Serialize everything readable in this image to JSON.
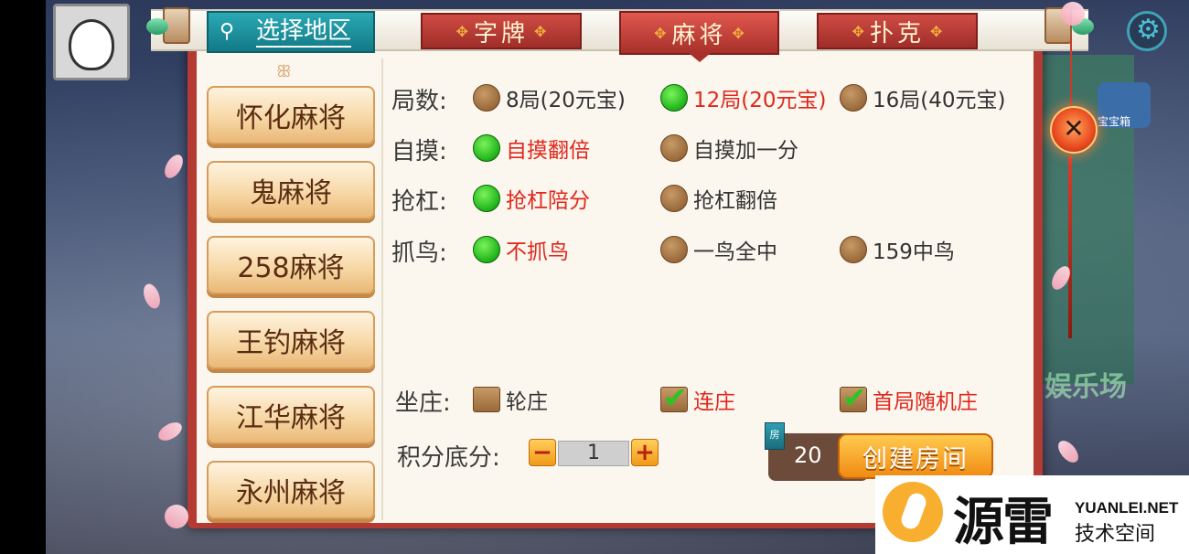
{
  "tabs": {
    "region": "选择地区",
    "zipai": "字牌",
    "majiang": "麻将",
    "puke": "扑克",
    "active": "麻将"
  },
  "game_list": [
    "怀化麻将",
    "鬼麻将",
    "258麻将",
    "王钓麻将",
    "江华麻将",
    "永州麻将"
  ],
  "options": {
    "rounds": {
      "label": "局数:",
      "choices": [
        {
          "text": "8局(20元宝)",
          "selected": false
        },
        {
          "text": "12局(20元宝)",
          "selected": true
        },
        {
          "text": "16局(40元宝)",
          "selected": false
        }
      ]
    },
    "self_draw": {
      "label": "自摸:",
      "choices": [
        {
          "text": "自摸翻倍",
          "selected": true
        },
        {
          "text": "自摸加一分",
          "selected": false
        }
      ]
    },
    "rob_kong": {
      "label": "抢杠:",
      "choices": [
        {
          "text": "抢杠陪分",
          "selected": true
        },
        {
          "text": "抢杠翻倍",
          "selected": false
        }
      ]
    },
    "catch_bird": {
      "label": "抓鸟:",
      "choices": [
        {
          "text": "不抓鸟",
          "selected": true
        },
        {
          "text": "一鸟全中",
          "selected": false
        },
        {
          "text": "159中鸟",
          "selected": false
        }
      ]
    },
    "banker": {
      "label": "坐庄:",
      "choices": [
        {
          "text": "轮庄",
          "checked": false
        },
        {
          "text": "连庄",
          "checked": true
        },
        {
          "text": "首局随机庄",
          "checked": true
        }
      ]
    }
  },
  "base_score": {
    "label": "积分底分:",
    "value": "1",
    "minus": "−",
    "plus": "+"
  },
  "create": {
    "card_icon_text": "房",
    "cost": "20",
    "button_label": "创建房间"
  },
  "close": {
    "symbol": "✕"
  },
  "background": {
    "happy_text": "娱乐场",
    "treasure_label": "宝宝箱"
  },
  "watermark": {
    "main": "源雷",
    "url": "YUANLEI.NET",
    "sub": "技术空间"
  },
  "colors": {
    "dialog_red": "#b43a34",
    "selected_text": "#e0271d",
    "radio_green": "#24b81e",
    "button_orange": "#f08a12",
    "region_teal": "#127a86"
  }
}
